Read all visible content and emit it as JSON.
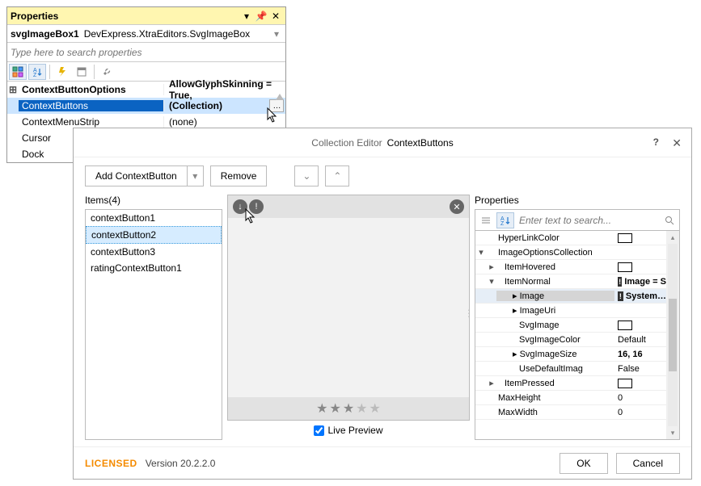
{
  "propsWindow": {
    "title": "Properties",
    "objectName": "svgImageBox1",
    "className": "DevExpress.XtraEditors.SvgImageBox",
    "searchPlaceholder": "Type here to search properties",
    "rows": {
      "r0": {
        "name": "ContextButtonOptions",
        "val": "AllowGlyphSkinning = True,"
      },
      "r1": {
        "name": "ContextButtons",
        "val": "(Collection)"
      },
      "r2": {
        "name": "ContextMenuStrip",
        "val": "(none)"
      },
      "r3": {
        "name": "Cursor",
        "val": ""
      },
      "r4": {
        "name": "Dock",
        "val": ""
      }
    }
  },
  "dialog": {
    "titlePrefix": "Collection Editor",
    "titleName": "ContextButtons",
    "toolbar": {
      "add": "Add ContextButton",
      "remove": "Remove"
    },
    "itemsHeader": "Items(4)",
    "items": [
      "contextButton1",
      "contextButton2",
      "contextButton3",
      "ratingContextButton1"
    ],
    "selectedItemIndex": 1,
    "livePreview": "Live Preview",
    "rightHeader": "Properties",
    "searchPlaceholder": "Enter text to search...",
    "grid": {
      "r0": {
        "name": "HyperLinkColor",
        "val": ""
      },
      "r1": {
        "name": "ImageOptionsCollection",
        "val": ""
      },
      "r2": {
        "name": "ItemHovered",
        "val": ""
      },
      "r3": {
        "name": "ItemNormal",
        "val": "Image = S"
      },
      "r4": {
        "name": "Image",
        "val": "System…"
      },
      "r5": {
        "name": "ImageUri",
        "val": ""
      },
      "r6": {
        "name": "SvgImage",
        "val": ""
      },
      "r7": {
        "name": "SvgImageColor",
        "val": "Default"
      },
      "r8": {
        "name": "SvgImageSize",
        "val": "16, 16"
      },
      "r9": {
        "name": "UseDefaultImag",
        "val": "False"
      },
      "r10": {
        "name": "ItemPressed",
        "val": ""
      },
      "r11": {
        "name": "MaxHeight",
        "val": "0"
      },
      "r12": {
        "name": "MaxWidth",
        "val": "0"
      }
    },
    "footer": {
      "licensed": "LICENSED",
      "version": "Version 20.2.2.0",
      "ok": "OK",
      "cancel": "Cancel"
    }
  }
}
